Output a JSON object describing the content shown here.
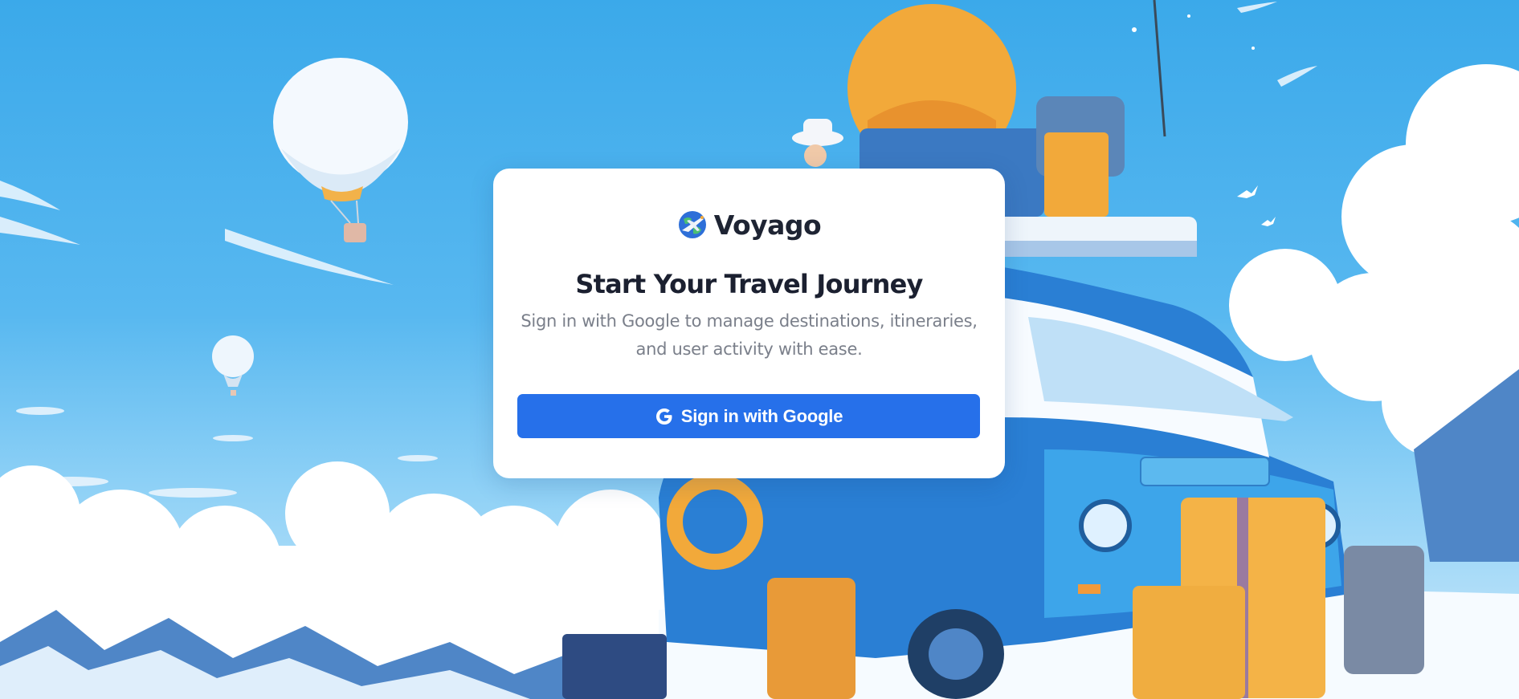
{
  "app": {
    "brand_name": "Voyago",
    "logo_icon": "globe-airplane-icon"
  },
  "login": {
    "title": "Start Your Travel Journey",
    "subtitle": "Sign in with Google to manage destinations, itineraries, and user activity with ease.",
    "google_button_label": "Sign in with Google",
    "google_button_icon": "google-g-icon"
  },
  "colors": {
    "primary_button": "#2670ea",
    "card_background": "#ffffff",
    "title_text": "#1b2030",
    "subtitle_text": "#7a7f8a",
    "sky": "#3ba9ea"
  }
}
